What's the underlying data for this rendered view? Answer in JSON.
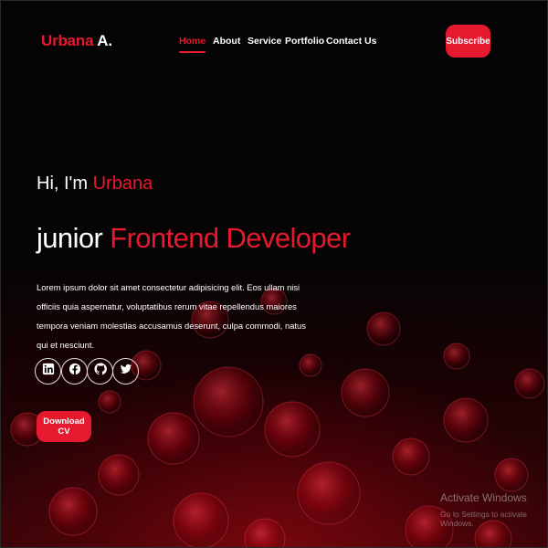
{
  "header": {
    "logo_first": "Urbana",
    "logo_second": " A.",
    "nav": [
      {
        "label": "Home",
        "active": true
      },
      {
        "label": "About",
        "active": false
      },
      {
        "label": "Service",
        "active": false
      },
      {
        "label": "Portfolio",
        "active": false
      },
      {
        "label": "Contact Us",
        "active": false
      }
    ],
    "subscribe_label": "Subscribe"
  },
  "hero": {
    "greeting_prefix": "Hi, I'm ",
    "greeting_name": "Urbana",
    "role_prefix": "junior ",
    "role_title": "Frontend Developer",
    "description": "Lorem ipsum dolor sit amet consectetur adipisicing elit. Eos ullam nisi officiis quia aspernatur, voluptatibus rerum vitae repellendus maiores tempora veniam molestias accusamus deserunt, culpa commodi, natus qui et nesciunt.",
    "socials": [
      {
        "icon": "linkedin-icon"
      },
      {
        "icon": "facebook-icon"
      },
      {
        "icon": "github-icon"
      },
      {
        "icon": "twitter-icon"
      }
    ],
    "download_label": "Download CV"
  },
  "watermark": {
    "title": "Activate Windows",
    "subtitle": "Go to Settings to activate Windows."
  },
  "colors": {
    "accent": "#e6192f",
    "background": "#050404",
    "text": "#ffffff"
  }
}
